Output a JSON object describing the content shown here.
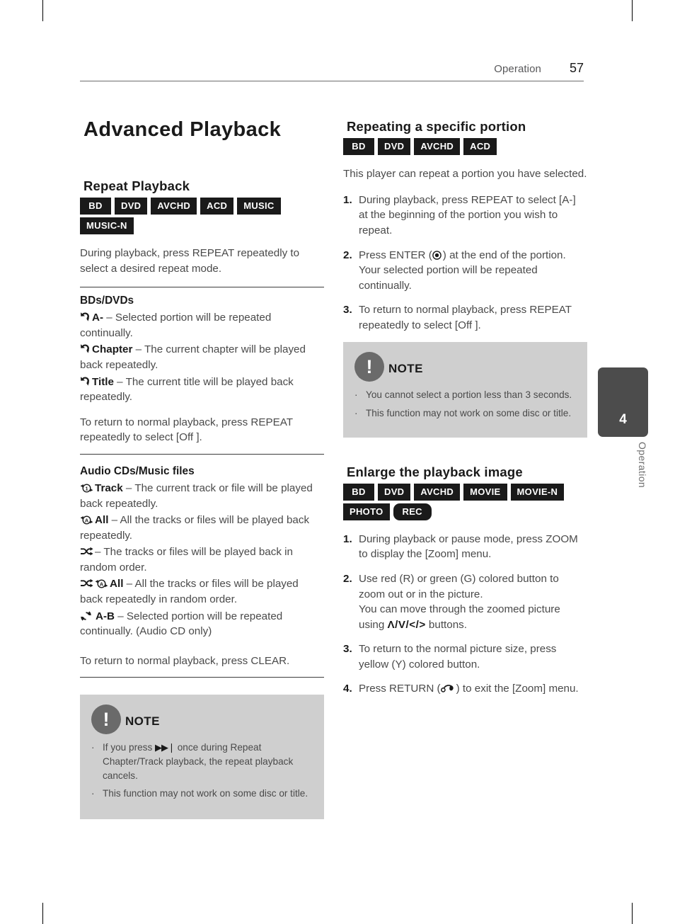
{
  "header": {
    "section": "Operation",
    "page_number": "57"
  },
  "side_tab": {
    "number": "4",
    "label": "Operation"
  },
  "left_column": {
    "page_title": "Advanced Playback",
    "repeat_playback": {
      "heading": "Repeat Playback",
      "badges": [
        "BD",
        "DVD",
        "AVCHD",
        "ACD",
        "MUSIC",
        "MUSIC-N"
      ],
      "intro": "During playback, press REPEAT repeatedly to select a desired repeat mode.",
      "bd_dvd": {
        "sub_title": "BDs/DVDs",
        "modes": [
          {
            "icon": "repeat-arrow-icon",
            "label": "A-",
            "desc": " – Selected portion will be repeated continually."
          },
          {
            "icon": "repeat-arrow-icon",
            "label": "Chapter",
            "desc": " – The current chapter will be played back repeatedly."
          },
          {
            "icon": "repeat-arrow-icon",
            "label": "Title",
            "desc": " – The current title will be played back repeatedly."
          }
        ],
        "footer": "To return to normal playback, press REPEAT repeatedly to select [Off ]."
      },
      "audio_cds": {
        "sub_title": "Audio CDs/Music files",
        "modes": [
          {
            "icon": "repeat-one-icon",
            "label": "Track",
            "desc": " – The current track or file will be played back repeatedly."
          },
          {
            "icon": "repeat-all-icon",
            "label": "All",
            "desc": " – All the tracks or files will be played back repeatedly."
          },
          {
            "icon": "shuffle-icon",
            "label": "",
            "desc": "– The tracks or files will be played back in random order."
          },
          {
            "icon": "shuffle-repeat-all-icon",
            "label": "All",
            "desc": " – All the tracks or files will be played back repeatedly in random order."
          },
          {
            "icon": "repeat-ab-icon",
            "label": "A-B",
            "desc": " – Selected portion will be repeated continually. (Audio CD only)"
          }
        ],
        "footer": "To return to normal playback, press CLEAR."
      },
      "note": {
        "icon": "exclamation-icon",
        "bang": "!",
        "title": "NOTE",
        "items": [
          {
            "pre": "If you press ",
            "glyph": "▶▶❘",
            "post": " once during Repeat Chapter/Track playback, the repeat playback cancels."
          },
          {
            "pre": "This function may not work on some disc or title.",
            "glyph": "",
            "post": ""
          }
        ]
      }
    }
  },
  "right_column": {
    "repeating_portion": {
      "heading": "Repeating a specific portion",
      "badges": [
        "BD",
        "DVD",
        "AVCHD",
        "ACD"
      ],
      "intro": "This player can repeat a portion you have selected.",
      "steps": [
        {
          "num": "1.",
          "text": "During playback, press REPEAT to select [A-] at the beginning of the portion you wish to repeat."
        },
        {
          "num": "2.",
          "text_pre": "Press ENTER (",
          "icon": "enter-dot-icon",
          "text_post": ") at the end of the portion. Your selected portion will be repeated continually."
        },
        {
          "num": "3.",
          "text": "To return to normal playback, press REPEAT repeatedly to select [Off ]."
        }
      ],
      "note": {
        "icon": "exclamation-icon",
        "bang": "!",
        "title": "NOTE",
        "items": [
          {
            "pre": "You cannot select a portion less than 3 seconds.",
            "glyph": "",
            "post": ""
          },
          {
            "pre": "This function may not work on some disc or title.",
            "glyph": "",
            "post": ""
          }
        ]
      }
    },
    "enlarge_image": {
      "heading": "Enlarge the playback image",
      "badges": [
        "BD",
        "DVD",
        "AVCHD",
        "MOVIE",
        "MOVIE-N",
        "PHOTO",
        "REC"
      ],
      "steps": [
        {
          "num": "1.",
          "text": "During playback or pause mode, press ZOOM to display the [Zoom] menu."
        },
        {
          "num": "2.",
          "text_pre": "Use red (R) or green (G) colored button to zoom out or in the picture.",
          "text_line2": "You can move through the zoomed picture using ",
          "glyph": "Λ/V/</>",
          "text_post": " buttons."
        },
        {
          "num": "3.",
          "text": "To return to the normal picture size, press yellow (Y) colored button."
        },
        {
          "num": "4.",
          "text_pre": "Press RETURN (",
          "icon": "return-arrow-icon",
          "text_post": ") to exit the [Zoom] menu."
        }
      ]
    }
  },
  "colors": {
    "badge_bg": "#1a1a1a",
    "note_bg": "#cfcfcf",
    "note_circle": "#6a6a6a",
    "side_tab": "#4c4c4c",
    "body_text": "#4a4a4a"
  }
}
